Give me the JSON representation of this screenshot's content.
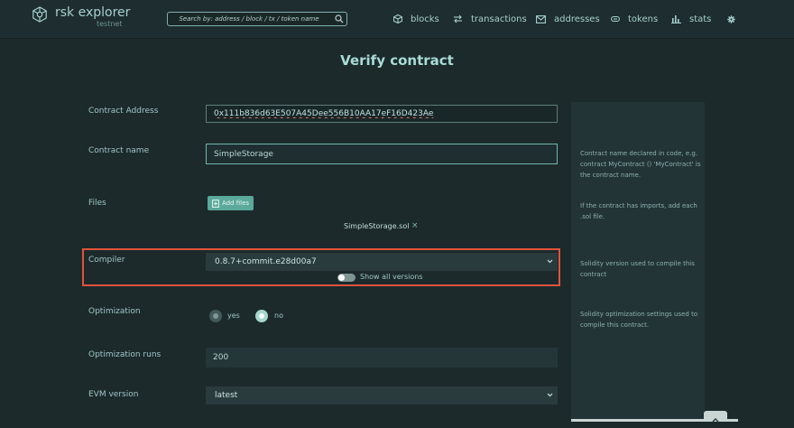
{
  "header": {
    "logo_name": "rsk explorer",
    "logo_network": "testnet",
    "search_placeholder": "Search by: address / block / tx / token name",
    "nav": {
      "blocks": "blocks",
      "transactions": "transactions",
      "addresses": "addresses",
      "tokens": "tokens",
      "stats": "stats"
    }
  },
  "page": {
    "title": "Verify contract"
  },
  "form": {
    "contract_address_label": "Contract Address",
    "contract_address_value": "0x111b836d63E507A45Dee556B10AA17eF16D423Ae",
    "contract_name_label": "Contract name",
    "contract_name_value": "SimpleStorage",
    "files_label": "Files",
    "add_files_label": "Add files",
    "file_name": "SimpleStorage.sol",
    "file_remove": "×",
    "compiler_label": "Compiler",
    "compiler_value": "0.8.7+commit.e28d00a7",
    "show_all_versions_label": "Show all versions",
    "show_all_versions_on": false,
    "optimization_label": "Optimization",
    "optimization_yes": "yes",
    "optimization_no": "no",
    "optimization_selected": "no",
    "optimization_runs_label": "Optimization runs",
    "optimization_runs_value": "200",
    "evm_version_label": "EVM version",
    "evm_version_value": "latest"
  },
  "help": {
    "contract_name": "Contract name declared in code, e.g. contract MyContract () 'MyContract' is the contract name.",
    "files": "If the contract has imports, add each .sol file.",
    "compiler": "Solidity version used to compile this contract",
    "optimization": "Solidity optimization settings used to compile this contract."
  },
  "colors": {
    "accent": "#5aa99a",
    "highlight": "#e2533b",
    "background": "#1c2a2c"
  }
}
